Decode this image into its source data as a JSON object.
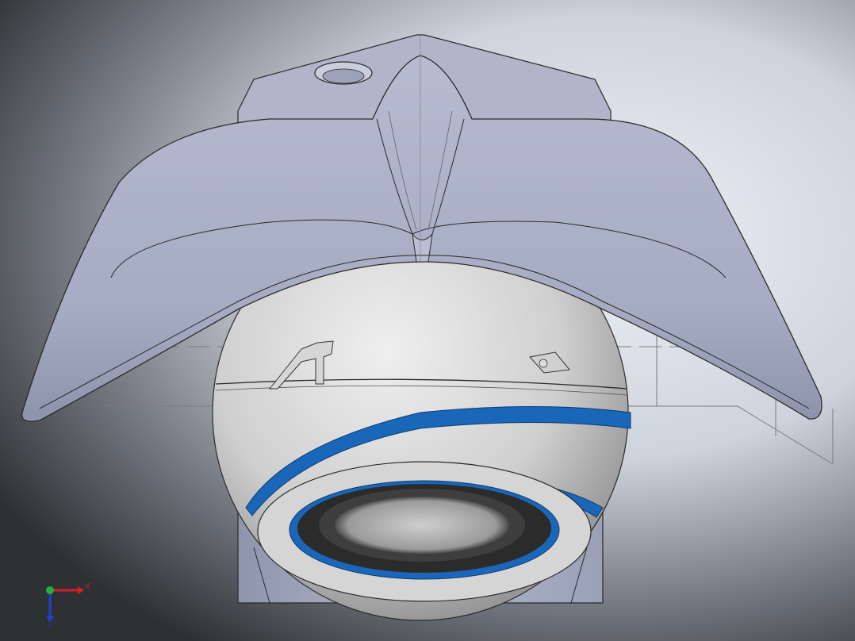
{
  "viewport": {
    "background_colors": [
      "#eef1f6",
      "#cdd3dd",
      "#6b6f77",
      "#2f3033"
    ]
  },
  "model": {
    "body_color": "#aab0c6",
    "sphere_color": "#d3d3d3",
    "accent_color": "#1a66b8",
    "lens_color": "#2b2b2b"
  },
  "triad": {
    "x_label": "X",
    "z_label": "Z",
    "x_color": "#d42020",
    "y_color": "#20b040",
    "z_color": "#2040d0"
  }
}
